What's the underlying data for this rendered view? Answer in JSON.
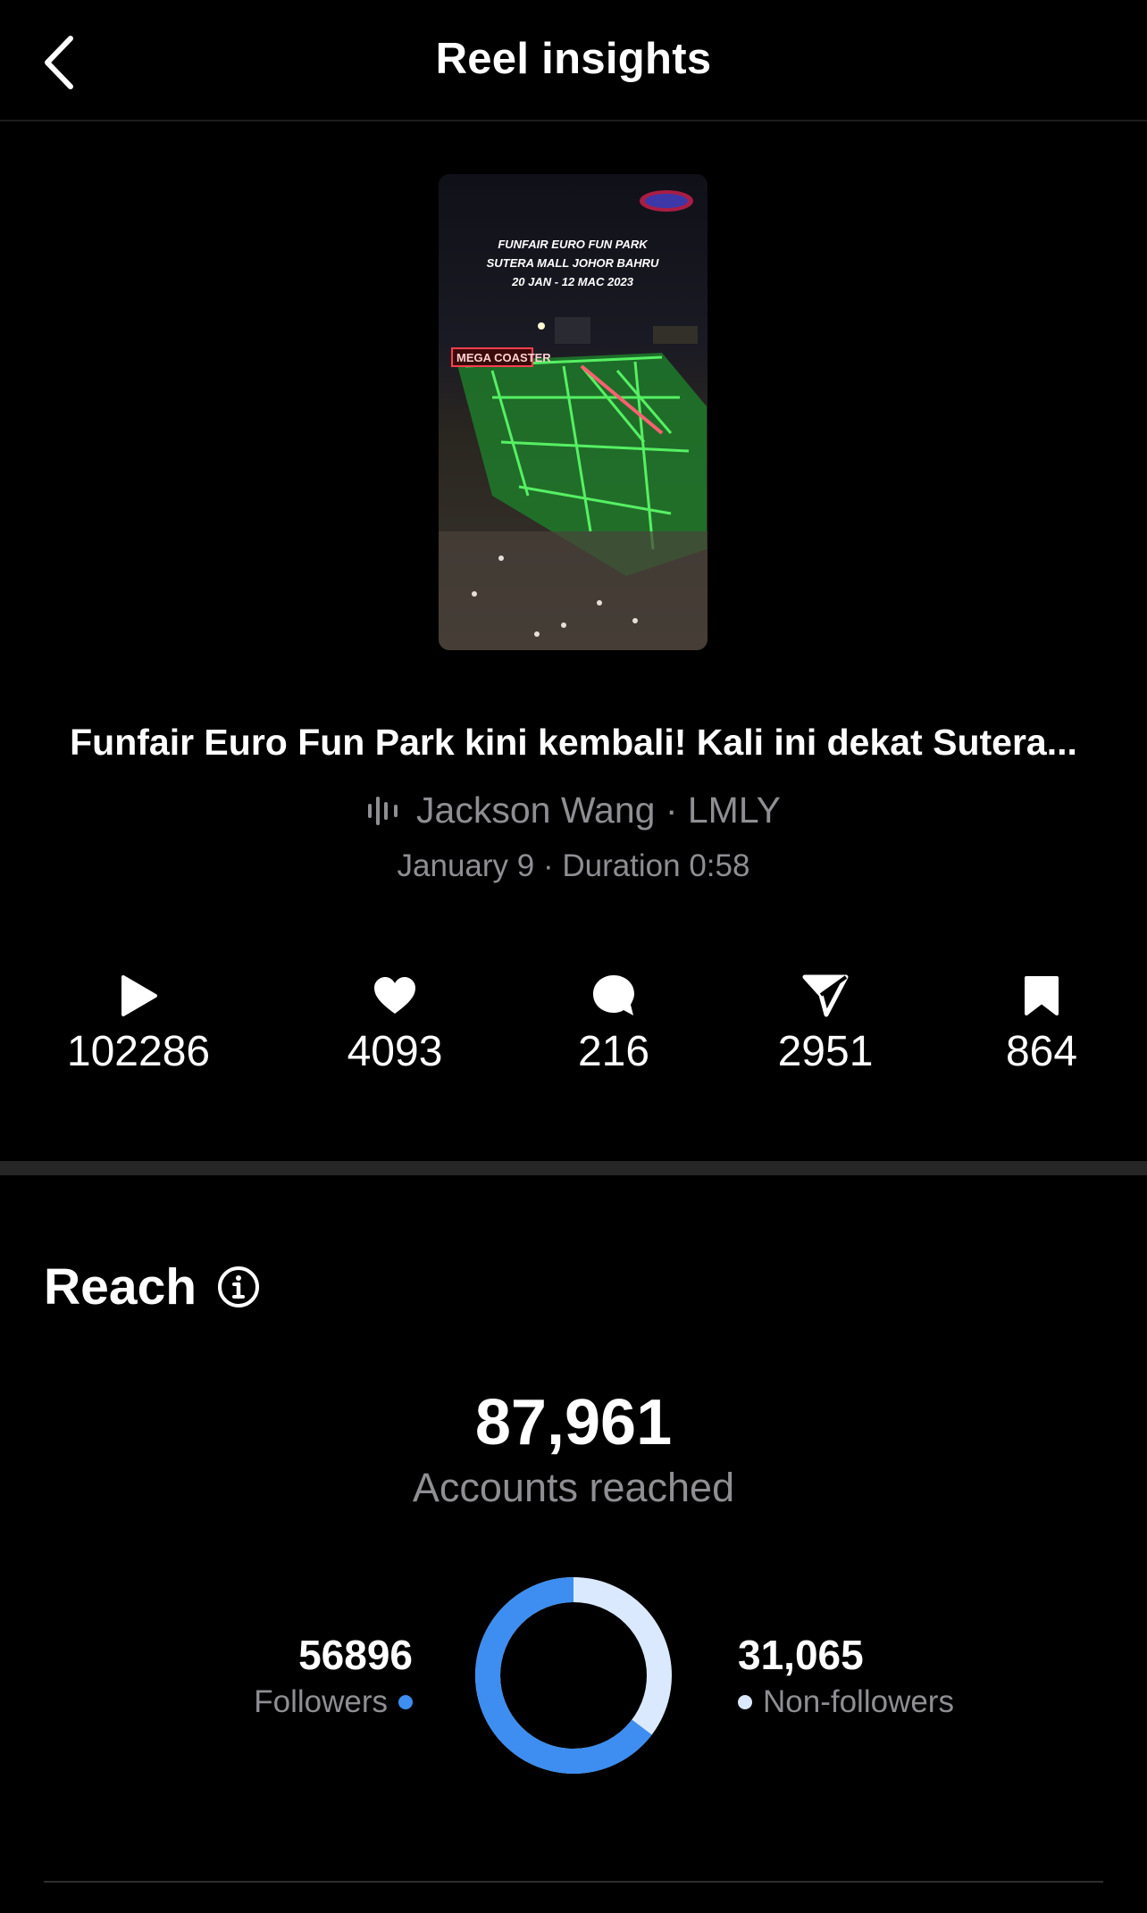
{
  "header": {
    "title": "Reel insights",
    "back_icon": "chevron-left-icon"
  },
  "reel": {
    "thumbnail_text_lines": [
      "FUNFAIR EURO FUN PARK",
      "SUTERA MALL JOHOR BAHRU",
      "20 JAN - 12 MAC 2023"
    ],
    "thumbnail_sign": "MEGA COASTER",
    "caption": "Funfair Euro Fun Park kini kembali! Kali ini dekat Sutera...",
    "audio": "Jackson Wang · LMLY",
    "audio_icon": "audio-waveform-icon",
    "meta": "January 9 · Duration 0:58"
  },
  "stats": [
    {
      "icon": "play-icon",
      "value": "102286"
    },
    {
      "icon": "heart-icon",
      "value": "4093"
    },
    {
      "icon": "comment-icon",
      "value": "216"
    },
    {
      "icon": "share-icon",
      "value": "2951"
    },
    {
      "icon": "bookmark-icon",
      "value": "864"
    }
  ],
  "reach": {
    "title": "Reach",
    "total": "87,961",
    "total_label": "Accounts reached",
    "followers_value": "56896",
    "followers_label": "Followers",
    "nonfollowers_value": "31,065",
    "nonfollowers_label": "Non-followers",
    "followers_fraction": 0.647,
    "colors": {
      "followers": "#3d8ef0",
      "nonfollowers": "#dbe9ff"
    }
  }
}
